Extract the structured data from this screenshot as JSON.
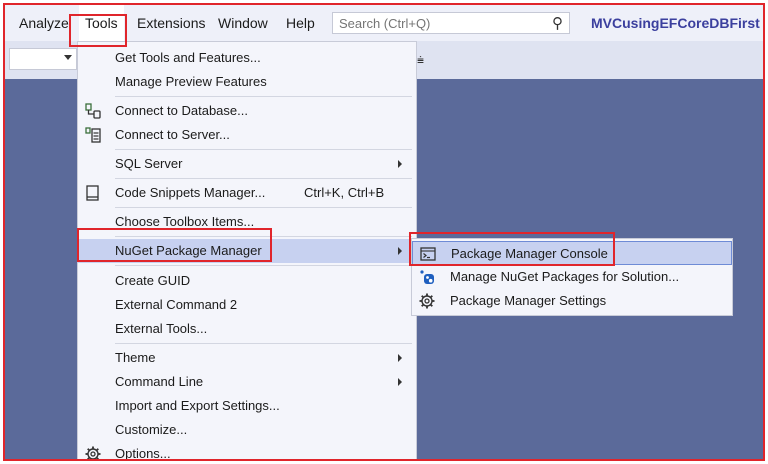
{
  "menubar": {
    "items": [
      {
        "label": "Analyze"
      },
      {
        "label": "Tools"
      },
      {
        "label": "Extensions"
      },
      {
        "label": "Window"
      },
      {
        "label": "Help"
      }
    ],
    "search_placeholder": "Search (Ctrl+Q)",
    "project_name": "MVCusingEFCoreDBFirst"
  },
  "toolbar": {
    "overflow_glyph": "⩧"
  },
  "tools_menu": {
    "items": [
      {
        "label": "Get Tools and Features..."
      },
      {
        "label": "Manage Preview Features"
      },
      {
        "label": "Connect to Database...",
        "icon": "database-connect-icon"
      },
      {
        "label": "Connect to Server...",
        "icon": "server-connect-icon"
      },
      {
        "label": "SQL Server"
      },
      {
        "label": "Code Snippets Manager...",
        "shortcut": "Ctrl+K, Ctrl+B",
        "icon": "snippet-icon"
      },
      {
        "label": "Choose Toolbox Items..."
      },
      {
        "label": "NuGet Package Manager"
      },
      {
        "label": "Create GUID"
      },
      {
        "label": "External Command 2"
      },
      {
        "label": "External Tools..."
      },
      {
        "label": "Theme"
      },
      {
        "label": "Command Line"
      },
      {
        "label": "Import and Export Settings..."
      },
      {
        "label": "Customize..."
      },
      {
        "label": "Options...",
        "icon": "gear-icon"
      }
    ]
  },
  "nuget_submenu": {
    "items": [
      {
        "label": "Package Manager Console",
        "icon": "console-icon"
      },
      {
        "label": "Manage NuGet Packages for Solution...",
        "icon": "nuget-icon"
      },
      {
        "label": "Package Manager Settings",
        "icon": "gear-icon"
      }
    ]
  },
  "colors": {
    "accent_red": "#e0252b",
    "highlight": "#c7d1f0",
    "menu_background": "#f4f5fb",
    "workspace": "#5b6a9a",
    "project_text": "#3b3f9e"
  }
}
